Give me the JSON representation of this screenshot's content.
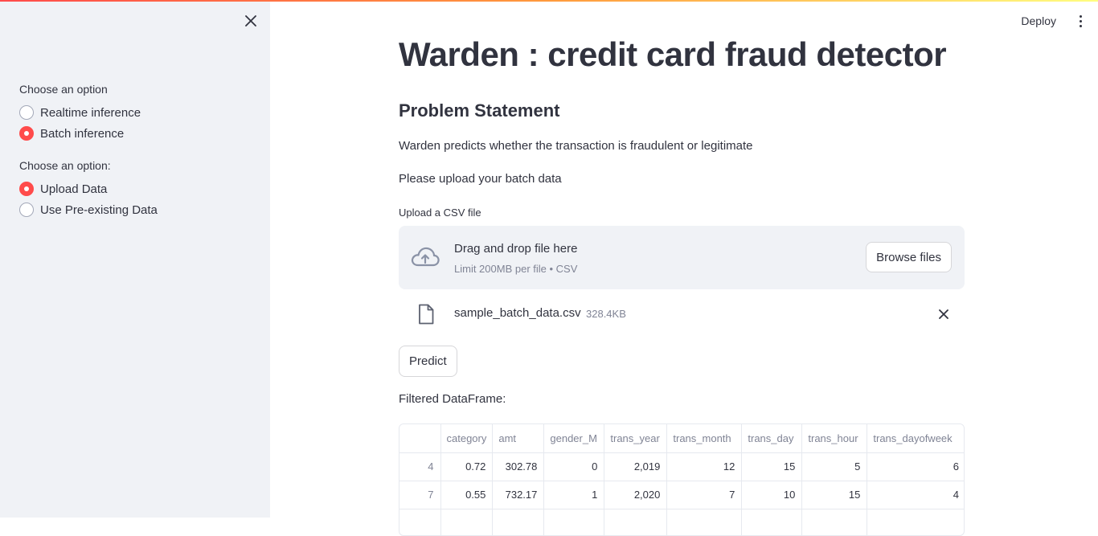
{
  "sidebar": {
    "close_icon": "close-icon",
    "group1": {
      "label": "Choose an option",
      "options": [
        {
          "label": "Realtime inference",
          "checked": false
        },
        {
          "label": "Batch inference",
          "checked": true
        }
      ]
    },
    "group2": {
      "label": "Choose an option:",
      "options": [
        {
          "label": "Upload Data",
          "checked": true
        },
        {
          "label": "Use Pre-existing Data",
          "checked": false
        }
      ]
    }
  },
  "header": {
    "deploy_label": "Deploy",
    "menu_icon": "kebab-menu-icon"
  },
  "main": {
    "title": "Warden : credit card fraud detector",
    "subtitle": "Problem Statement",
    "description": "Warden predicts whether the transaction is fraudulent or legitimate",
    "instruction": "Please upload your batch data",
    "uploader": {
      "label": "Upload a CSV file",
      "drop_title": "Drag and drop file here",
      "drop_subtitle": "Limit 200MB per file • CSV",
      "browse_label": "Browse files",
      "icon": "cloud-upload-icon"
    },
    "file": {
      "name": "sample_batch_data.csv",
      "size": "328.4KB",
      "icon": "file-icon"
    },
    "predict_label": "Predict",
    "dataframe_label": "Filtered DataFrame:",
    "table": {
      "columns": [
        "",
        "category",
        "amt",
        "gender_M",
        "trans_year",
        "trans_month",
        "trans_day",
        "trans_hour",
        "trans_dayofweek"
      ],
      "rows": [
        [
          "4",
          "0.72",
          "302.78",
          "0",
          "2,019",
          "12",
          "15",
          "5",
          "6"
        ],
        [
          "7",
          "0.55",
          "732.17",
          "1",
          "2,020",
          "7",
          "10",
          "15",
          "4"
        ],
        [
          "",
          "",
          "",
          "",
          "",
          "",
          "",
          "",
          ""
        ]
      ]
    }
  },
  "colors": {
    "accent": "#ff4b4b",
    "sidebar_bg": "#f0f2f6",
    "text": "#31333f",
    "muted": "#808495"
  }
}
